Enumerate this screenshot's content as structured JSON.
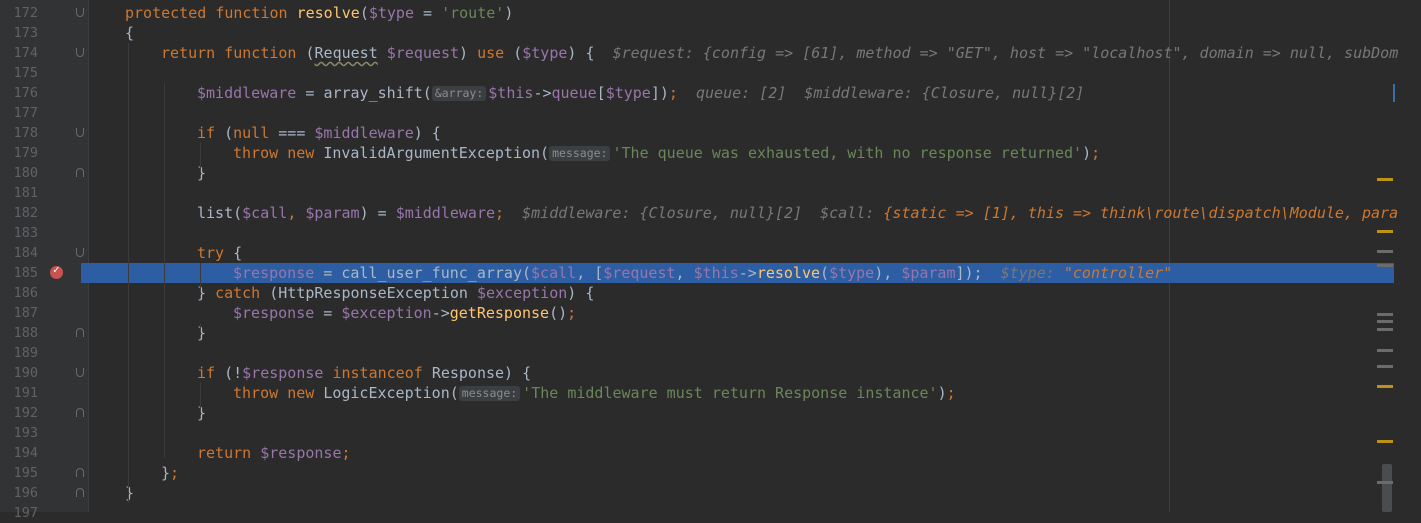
{
  "editor": {
    "lines": [
      {
        "num": "172",
        "tokens": [
          {
            "t": "protected ",
            "c": "kw"
          },
          {
            "t": "function ",
            "c": "kw"
          },
          {
            "t": "resolve",
            "c": "fn"
          },
          {
            "t": "(",
            "c": "plain"
          },
          {
            "t": "$type",
            "c": "var"
          },
          {
            "t": " = ",
            "c": "plain"
          },
          {
            "t": "'route'",
            "c": "str"
          },
          {
            "t": ")",
            "c": "plain"
          }
        ]
      },
      {
        "num": "173",
        "tokens": [
          {
            "t": "{",
            "c": "plain"
          }
        ]
      },
      {
        "num": "174",
        "tokens": [
          {
            "t": "return ",
            "c": "kw"
          },
          {
            "t": "function ",
            "c": "kw"
          },
          {
            "t": "(",
            "c": "plain"
          },
          {
            "t": "Request",
            "c": "cls"
          },
          {
            "t": " ",
            "c": "plain"
          },
          {
            "t": "$request",
            "c": "var"
          },
          {
            "t": ") ",
            "c": "plain"
          },
          {
            "t": "use ",
            "c": "kw"
          },
          {
            "t": "(",
            "c": "plain"
          },
          {
            "t": "$type",
            "c": "var"
          },
          {
            "t": ") {  ",
            "c": "plain"
          },
          {
            "t": "$request: {config => [61], method => \"GET\", host => \"localhost\", domain => null, subDom",
            "c": "hint"
          }
        ]
      },
      {
        "num": "175",
        "tokens": []
      },
      {
        "num": "176",
        "tokens": [
          {
            "t": "$middleware",
            "c": "var"
          },
          {
            "t": " = ",
            "c": "plain"
          },
          {
            "t": "array_shift(",
            "c": "plain"
          },
          {
            "t": "&array:",
            "c": "param"
          },
          {
            "t": "$this",
            "c": "var"
          },
          {
            "t": "->",
            "c": "plain"
          },
          {
            "t": "queue",
            "c": "var"
          },
          {
            "t": "[",
            "c": "plain"
          },
          {
            "t": "$type",
            "c": "var"
          },
          {
            "t": "])",
            "c": "plain"
          },
          {
            "t": ";",
            "c": "kw"
          },
          {
            "t": "  queue: [2]  $middleware: {Closure, null}[2]",
            "c": "hint"
          }
        ]
      },
      {
        "num": "177",
        "tokens": []
      },
      {
        "num": "178",
        "tokens": [
          {
            "t": "if ",
            "c": "kw"
          },
          {
            "t": "(",
            "c": "plain"
          },
          {
            "t": "null",
            "c": "kw"
          },
          {
            "t": " === ",
            "c": "plain"
          },
          {
            "t": "$middleware",
            "c": "var"
          },
          {
            "t": ") {",
            "c": "plain"
          }
        ]
      },
      {
        "num": "179",
        "tokens": [
          {
            "t": "throw ",
            "c": "kw"
          },
          {
            "t": "new ",
            "c": "kw"
          },
          {
            "t": "InvalidArgumentException(",
            "c": "plain"
          },
          {
            "t": "message:",
            "c": "param"
          },
          {
            "t": "'The queue was exhausted, with no response returned'",
            "c": "str"
          },
          {
            "t": ")",
            "c": "plain"
          },
          {
            "t": ";",
            "c": "kw"
          }
        ]
      },
      {
        "num": "180",
        "tokens": [
          {
            "t": "}",
            "c": "plain"
          }
        ]
      },
      {
        "num": "181",
        "tokens": []
      },
      {
        "num": "182",
        "tokens": [
          {
            "t": "list(",
            "c": "plain"
          },
          {
            "t": "$call",
            "c": "var"
          },
          {
            "t": ", ",
            "c": "kw"
          },
          {
            "t": "$param",
            "c": "var"
          },
          {
            "t": ") = ",
            "c": "plain"
          },
          {
            "t": "$middleware",
            "c": "var"
          },
          {
            "t": ";",
            "c": "kw"
          },
          {
            "t": "  $middleware: {Closure, null}[2]  $call: ",
            "c": "hint"
          },
          {
            "t": "{static => [1], this => think\\route\\dispatch\\Module, para",
            "c": "hintval"
          }
        ]
      },
      {
        "num": "183",
        "tokens": []
      },
      {
        "num": "184",
        "tokens": [
          {
            "t": "try ",
            "c": "kw"
          },
          {
            "t": "{",
            "c": "plain"
          }
        ]
      },
      {
        "num": "185",
        "tokens": [
          {
            "t": "$response",
            "c": "var"
          },
          {
            "t": " = ",
            "c": "plain"
          },
          {
            "t": "call_user_func_array(",
            "c": "plain"
          },
          {
            "t": "$call",
            "c": "var"
          },
          {
            "t": ", [",
            "c": "plain"
          },
          {
            "t": "$request",
            "c": "var"
          },
          {
            "t": ", ",
            "c": "plain"
          },
          {
            "t": "$this",
            "c": "var"
          },
          {
            "t": "->",
            "c": "plain"
          },
          {
            "t": "resolve",
            "c": "fn"
          },
          {
            "t": "(",
            "c": "plain"
          },
          {
            "t": "$type",
            "c": "var"
          },
          {
            "t": "), ",
            "c": "plain"
          },
          {
            "t": "$param",
            "c": "var"
          },
          {
            "t": "]);",
            "c": "plain"
          },
          {
            "t": "  $type: ",
            "c": "hint"
          },
          {
            "t": "\"controller\"",
            "c": "hintstr"
          }
        ]
      },
      {
        "num": "186",
        "tokens": [
          {
            "t": "} ",
            "c": "plain"
          },
          {
            "t": "catch ",
            "c": "kw"
          },
          {
            "t": "(HttpResponseException ",
            "c": "plain"
          },
          {
            "t": "$exception",
            "c": "var"
          },
          {
            "t": ") {",
            "c": "plain"
          }
        ]
      },
      {
        "num": "187",
        "tokens": [
          {
            "t": "$response",
            "c": "var"
          },
          {
            "t": " = ",
            "c": "plain"
          },
          {
            "t": "$exception",
            "c": "var"
          },
          {
            "t": "->",
            "c": "plain"
          },
          {
            "t": "getResponse",
            "c": "fn"
          },
          {
            "t": "()",
            "c": "plain"
          },
          {
            "t": ";",
            "c": "kw"
          }
        ]
      },
      {
        "num": "188",
        "tokens": [
          {
            "t": "}",
            "c": "plain"
          }
        ]
      },
      {
        "num": "189",
        "tokens": []
      },
      {
        "num": "190",
        "tokens": [
          {
            "t": "if ",
            "c": "kw"
          },
          {
            "t": "(!",
            "c": "plain"
          },
          {
            "t": "$response",
            "c": "var"
          },
          {
            "t": " instanceof ",
            "c": "kw"
          },
          {
            "t": "Response) {",
            "c": "plain"
          }
        ]
      },
      {
        "num": "191",
        "tokens": [
          {
            "t": "throw ",
            "c": "kw"
          },
          {
            "t": "new ",
            "c": "kw"
          },
          {
            "t": "LogicException(",
            "c": "plain"
          },
          {
            "t": "message:",
            "c": "param"
          },
          {
            "t": "'The middleware must return Response instance'",
            "c": "str"
          },
          {
            "t": ")",
            "c": "plain"
          },
          {
            "t": ";",
            "c": "kw"
          }
        ]
      },
      {
        "num": "192",
        "tokens": [
          {
            "t": "}",
            "c": "plain"
          }
        ]
      },
      {
        "num": "193",
        "tokens": []
      },
      {
        "num": "194",
        "tokens": [
          {
            "t": "return ",
            "c": "kw"
          },
          {
            "t": "$response",
            "c": "var"
          },
          {
            "t": ";",
            "c": "kw"
          }
        ]
      },
      {
        "num": "195",
        "tokens": [
          {
            "t": "}",
            "c": "plain"
          },
          {
            "t": ";",
            "c": "kw"
          }
        ]
      },
      {
        "num": "196",
        "tokens": [
          {
            "t": "}",
            "c": "plain"
          }
        ]
      },
      {
        "num": "197",
        "tokens": []
      }
    ],
    "highlighted_line": "185",
    "breakpoint_line": "185",
    "colors": {
      "highlight": "#2d5ea3",
      "background": "#2b2b2b",
      "breakpoint": "#c75450"
    }
  }
}
